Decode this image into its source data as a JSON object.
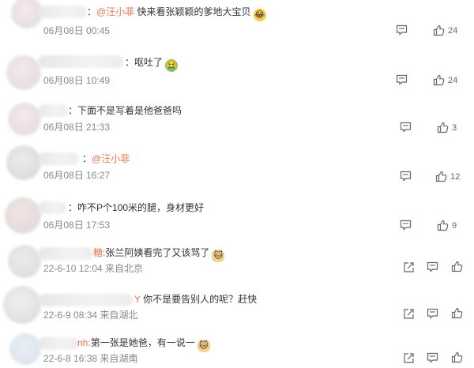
{
  "comments": [
    {
      "mention": "@汪小菲",
      "text": "快来看张颖颖的爹地大宝贝",
      "emoji": "laugh-emoji",
      "time": "06月08日 00:45",
      "likes": "24"
    },
    {
      "mention": "",
      "text": "呕吐了",
      "emoji": "vomit-emoji",
      "time": "06月08日 10:49",
      "likes": "24"
    },
    {
      "mention": "",
      "text": "下面不是写着是他爸爸吗",
      "emoji": "",
      "time": "06月08日 21:33",
      "likes": "3"
    },
    {
      "mention": "@汪小菲",
      "text": "",
      "emoji": "",
      "time": "06月08日 16:27",
      "likes": "12"
    },
    {
      "mention": "",
      "text": "咋不P个100米的腿，身材更好",
      "emoji": "",
      "time": "06月08日 17:53",
      "likes": "9"
    }
  ],
  "replies": [
    {
      "name_tail": "糖:",
      "text": "张兰阿姨看完了又该骂了",
      "emoji": "cat-emoji",
      "time": "22-6-10 12:04 来自北京"
    },
    {
      "name_tail": "Y",
      "text": "你不是要告别人的呢？赶快",
      "emoji": "",
      "time": "22-6-9 08:34 来自湖北"
    },
    {
      "name_tail": "nh:",
      "text": "第一张是她爸，有一说一",
      "emoji": "cat-emoji",
      "time": "22-6-8 16:38 来自湖南"
    }
  ],
  "icons": {
    "comment": "comment-icon",
    "like": "thumbs-up-icon",
    "share": "share-icon"
  }
}
